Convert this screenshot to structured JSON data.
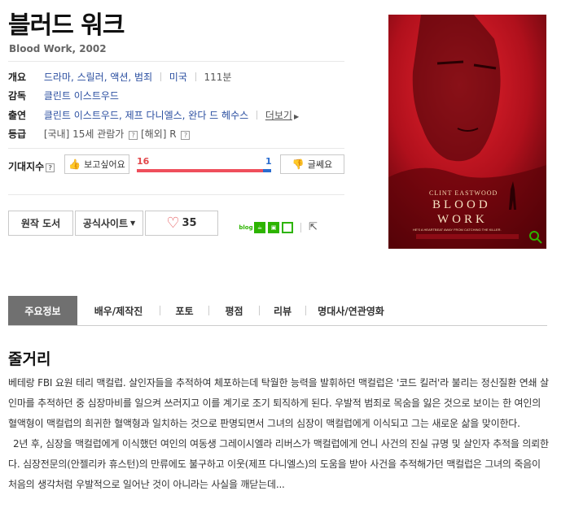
{
  "movie": {
    "title": "블러드 워크",
    "subtitle": "Blood Work, 2002"
  },
  "info": {
    "overview_label": "개요",
    "genres": "드라마, 스릴러, 액션, 범죄",
    "country": "미국",
    "runtime": "111분",
    "director_label": "감독",
    "director": "클린트 이스트우드",
    "cast_label": "출연",
    "cast": "클린트 이스트우드, 제프 다니엘스, 완다 드 헤수스",
    "more_label": "더보기",
    "rating_label": "등급",
    "rating_domestic": "[국내] 15세 관람가",
    "rating_foreign": "[해외] R"
  },
  "expectation": {
    "label": "기대지수",
    "want_label": "보고싶어요",
    "dislike_label": "글쎄요",
    "want_count": "16",
    "dislike_count": "1",
    "want_ratio": 0.94
  },
  "actions": {
    "original_book": "원작 도서",
    "official_site": "공식사이트",
    "like_count": "35",
    "share_icons": [
      "blog",
      "cafe",
      "band",
      "book"
    ]
  },
  "poster": {
    "credit": "CLINT EASTWOOD",
    "title_line1": "BLOOD",
    "title_line2": "WORK",
    "tagline": "HE'S A HEARTBEAT AWAY FROM CATCHING THE KILLER."
  },
  "tabs": [
    {
      "label": "주요정보",
      "active": true
    },
    {
      "label": "배우/제작진",
      "active": false
    },
    {
      "label": "포토",
      "active": false
    },
    {
      "label": "평점",
      "active": false
    },
    {
      "label": "리뷰",
      "active": false
    },
    {
      "label": "명대사/연관영화",
      "active": false
    }
  ],
  "synopsis": {
    "title": "줄거리",
    "para1": "베테랑 FBI 요원 테리 맥컬럽. 살인자들을 추적하여 체포하는데 탁월한 능력을 발휘하던 맥컬럽은 '코드 킬러'라 불리는 정신질환 연쇄 살인마를 추적하던 중 심장마비를 일으켜 쓰러지고 이를 계기로 조기 퇴직하게 된다. 우발적 범죄로 목숨을 잃은 것으로 보이는 한 여인의 혈액형이 맥컬럽의 희귀한 혈액형과 일치하는 것으로 판명되면서 그녀의 심장이 맥컬럽에게 이식되고 그는 새로운 삶을 맞이한다.",
    "para2": "2년 후, 심장을 맥컬럽에게 이식했던 여인의 여동생 그레이시엘라 리버스가 맥컬럽에게 언니 사건의 진실 규명 및 살인자 추적을 의뢰한다. 심장전문의(안젤리카 휴스턴)의 만류에도 불구하고 이웃(제프 다니엘스)의 도움을 받아 사건을 추적해가던 맥컬럽은 그녀의 죽음이 처음의 생각처럼 우발적으로 일어난 것이 아니라는 사실을 깨닫는데..."
  }
}
